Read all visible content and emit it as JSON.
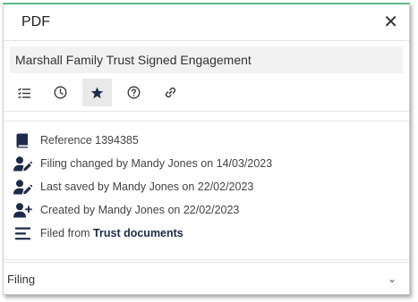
{
  "panel": {
    "title": "PDF",
    "close_glyph": "✕",
    "document_name": "Marshall Family Trust Signed Engagement"
  },
  "toolbar": {
    "buttons": [
      {
        "icon": "checklist-icon",
        "active": false
      },
      {
        "icon": "clock-icon",
        "active": false
      },
      {
        "icon": "star-icon",
        "active": true
      },
      {
        "icon": "help-icon",
        "active": false
      },
      {
        "icon": "link-icon",
        "active": false
      }
    ]
  },
  "info": {
    "reference": "Reference 1394385",
    "filing_changed": "Filing changed by Mandy Jones on 14/03/2023",
    "last_saved": "Last saved by Mandy Jones on 22/02/2023",
    "created": "Created by Mandy Jones on 22/02/2023",
    "filed_from_prefix": "Filed from ",
    "filed_from_location": "Trust documents"
  },
  "filing_section": {
    "label": "Filing",
    "chevron": "⌄"
  },
  "colors": {
    "accent_top": "#5cb88a",
    "icon_dark": "#1d2b4a"
  }
}
